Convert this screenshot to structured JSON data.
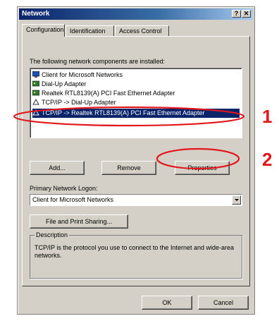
{
  "window": {
    "title": "Network",
    "help_btn": "?",
    "close_btn": "✕"
  },
  "tabs": [
    {
      "label": "Configuration"
    },
    {
      "label": "Identification"
    },
    {
      "label": "Access Control"
    }
  ],
  "components_label": "The following network components are installed:",
  "components": [
    {
      "label": "Client for Microsoft Networks",
      "icon": "network-client-icon"
    },
    {
      "label": "Dial-Up Adapter",
      "icon": "adapter-icon"
    },
    {
      "label": "Realtek RTL8139(A) PCI Fast Ethernet Adapter",
      "icon": "adapter-icon"
    },
    {
      "label": "TCP/IP -> Dial-Up Adapter",
      "icon": "protocol-icon"
    },
    {
      "label": "TCP/IP -> Realtek RTL8139(A) PCI Fast Ethernet Adapter",
      "icon": "protocol-icon",
      "selected": true
    }
  ],
  "buttons": {
    "add": "Add...",
    "remove": "Remove",
    "properties": "Properties",
    "file_print": "File and Print Sharing...",
    "ok": "OK",
    "cancel": "Cancel"
  },
  "logon": {
    "label": "Primary Network Logon:",
    "value": "Client for Microsoft Networks"
  },
  "description": {
    "title": "Description",
    "text": "TCP/IP is the protocol you use to connect to the Internet and wide-area networks."
  },
  "annotations": {
    "step1": "1",
    "step2": "2",
    "color": "#e3171b"
  }
}
